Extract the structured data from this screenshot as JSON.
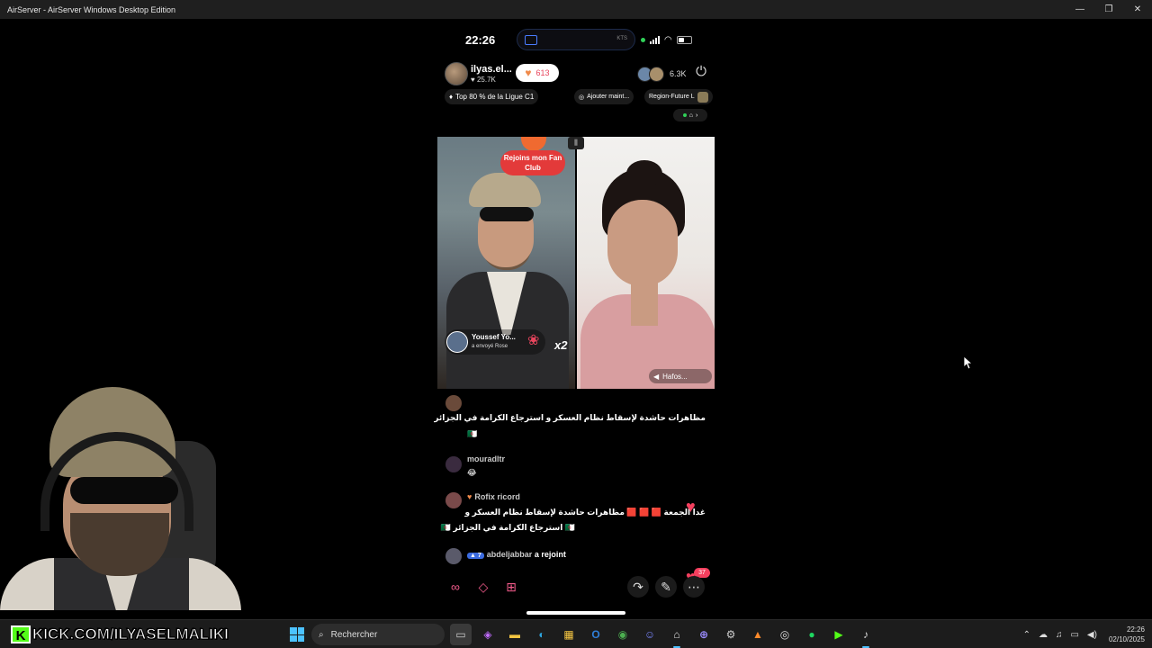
{
  "window": {
    "title": "AirServer - AirServer Windows Desktop Edition",
    "controls": [
      "—",
      "❐",
      "✕"
    ]
  },
  "phone": {
    "status": {
      "time": "22:26",
      "island_right": "KTS"
    },
    "host": {
      "name": "ilyas.el...",
      "likes": "♥ 25.7K",
      "follow_count": "613",
      "viewers": "6.3K"
    },
    "tags": {
      "rank": "Top 80 % de la Ligue C1",
      "add": "Ajouter maint...",
      "region": "Region-Future L"
    },
    "video": {
      "fan_club": "Rejoins mon Fan Club",
      "gift": {
        "sender": "Youssef Yo...",
        "action": "a envoyé Rose",
        "multiplier": "x2"
      },
      "right_label": "Hafos..."
    },
    "chat": [
      {
        "user": "",
        "text": "مظاهرات حاشدة لإسقاط نظام العسكر و استرجاع الكرامة في الجزائر",
        "emoji": "🇩🇿"
      },
      {
        "user": "mouradltr",
        "text": "",
        "emoji": "😂"
      },
      {
        "user": "Rofix ricord",
        "text": "غدا الجمعة 🟥 🟥 🟥 مظاهرات حاشدة لإسقاط نظام العسكر و",
        "text2": "🇩🇿 استرجاع الكرامة في الجزائر 🇩🇿"
      },
      {
        "user": "abdeljabbar",
        "rank": "7",
        "text": "a rejoint"
      }
    ],
    "heart_count": "37"
  },
  "taskbar": {
    "kick": "KICK.COM/ILYASELMALIKI",
    "search": "Rechercher",
    "time": "22:26",
    "date": "02/10/2025"
  },
  "colors": {
    "kick_green": "#53fc18",
    "accent": "#4cc2ff",
    "heart": "#f43f5e"
  }
}
